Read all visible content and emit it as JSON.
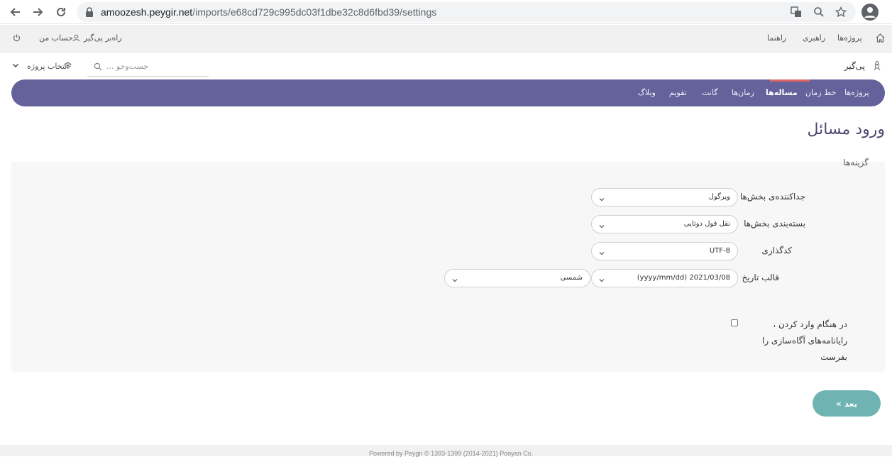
{
  "browser": {
    "url_host": "amoozesh.peygir.net",
    "url_path": "/imports/e68cd729c995dc03f1dbe32c8d6fbd39/settings"
  },
  "topbar": {
    "home": "",
    "projects": "پروژه‌ها",
    "guidance": "راهبری",
    "help": "راهنما",
    "rahbar_user": "راه‌بر پی‌گیر",
    "my_account": "حساب من"
  },
  "secbar": {
    "brand": "پی‌گیر",
    "search_placeholder": "جست‌وجو ...",
    "select_project": "انتخاب پروژه"
  },
  "menu": {
    "items": [
      "پروژه‌ها",
      "خط زمان",
      "مساله‌ها",
      "زمان‌ها",
      "گانت",
      "تقویم",
      "وبلاگ"
    ]
  },
  "page": {
    "title": "ورود مسائل",
    "legend": "گزینه‌ها"
  },
  "form": {
    "separator_label": "جداکننده‌ی بخش‌ها",
    "separator_value": "ویرگول",
    "wrapper_label": "بسته‌بندی بخش‌ها",
    "wrapper_value": "نقل قول دوتایی",
    "encoding_label": "کدگذاری",
    "encoding_value": "UTF-8",
    "date_label": "قالب تاریخ",
    "date_value": "2021/03/08 (yyyy/mm/dd)",
    "calendar_value": "شمسی",
    "notify_label": "در هنگام وارد کردن ، رایانامه‌های آگاه‌سازی را بفرست"
  },
  "buttons": {
    "next": "بعد »"
  },
  "footer": {
    "text": "Powered by Peygir © 1393-1399 (2014-2021) Pooyan Co."
  },
  "colors": {
    "menu_bg": "#64619b",
    "active_indicator": "#e06464",
    "next_button": "#6fb4b3",
    "title": "#4a4870"
  }
}
